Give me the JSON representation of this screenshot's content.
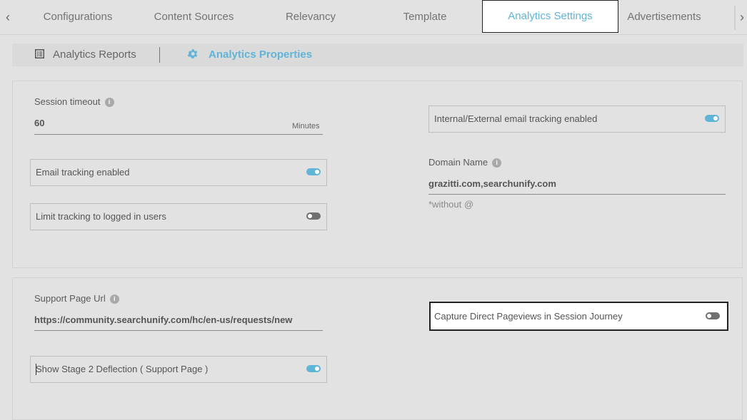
{
  "tabs": {
    "prev_arrow": "‹",
    "next_arrow": "›",
    "items": [
      {
        "label": "Configurations"
      },
      {
        "label": "Content Sources"
      },
      {
        "label": "Relevancy"
      },
      {
        "label": "Template"
      },
      {
        "label": "Analytics Settings",
        "active": true
      },
      {
        "label": "Advertisements"
      }
    ]
  },
  "subnav": {
    "reports": "Analytics Reports",
    "properties": "Analytics Properties"
  },
  "general": {
    "session_timeout_label": "Session timeout",
    "session_timeout_value": "60",
    "session_timeout_unit": "Minutes",
    "email_tracking_label": "Email tracking enabled",
    "email_tracking_on": true,
    "limit_tracking_label": "Limit tracking to logged in users",
    "limit_tracking_on": false,
    "internal_external_label": "Internal/External email tracking enabled",
    "internal_external_on": true,
    "domain_label": "Domain Name",
    "domain_value": "grazitti.com,searchunify.com",
    "domain_hint": "*without @"
  },
  "support": {
    "url_label": "Support Page Url",
    "url_value": "https://community.searchunify.com/hc/en-us/requests/new",
    "stage2_label": "Show Stage 2 Deflection ( Support Page )",
    "stage2_on": true,
    "capture_direct_label": "Capture Direct Pageviews in Session Journey",
    "capture_direct_on": false
  },
  "icons": {
    "info": "i"
  },
  "colors": {
    "accent": "#5fb5d8",
    "background": "#e2e2e2"
  }
}
